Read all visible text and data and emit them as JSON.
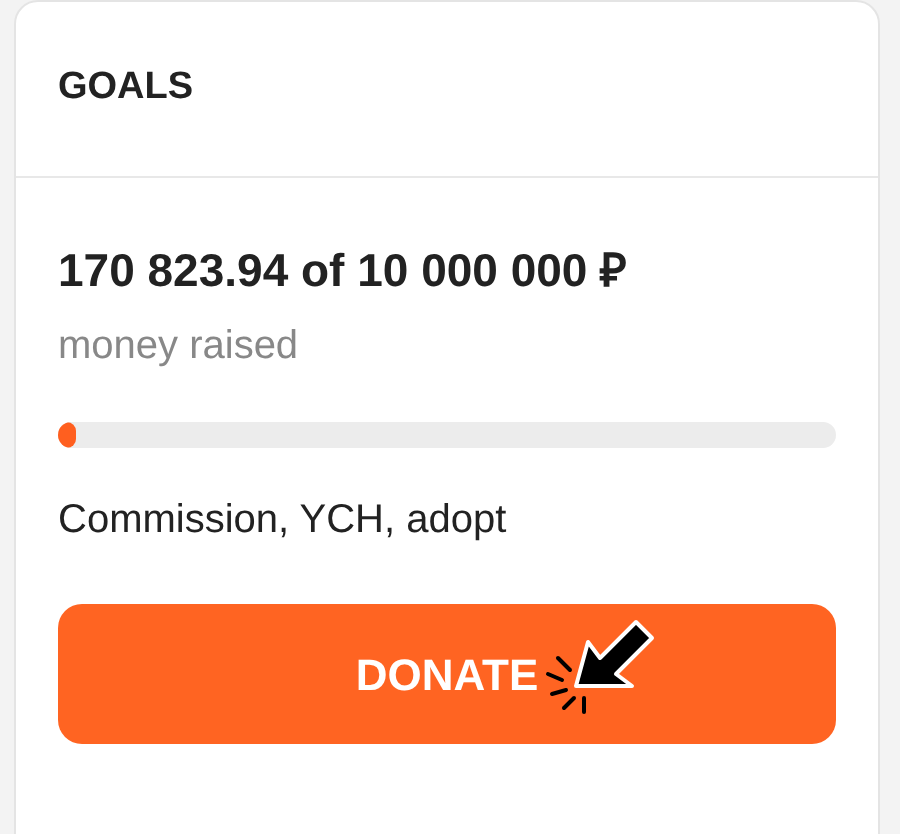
{
  "card": {
    "title": "GOALS"
  },
  "goal": {
    "amount": "170 823.94 of 10 000 000 ₽",
    "caption": "money raised",
    "level": 0.017,
    "description": "Commission, YCH, adopt"
  },
  "donate_button": {
    "label": "DONATE"
  }
}
